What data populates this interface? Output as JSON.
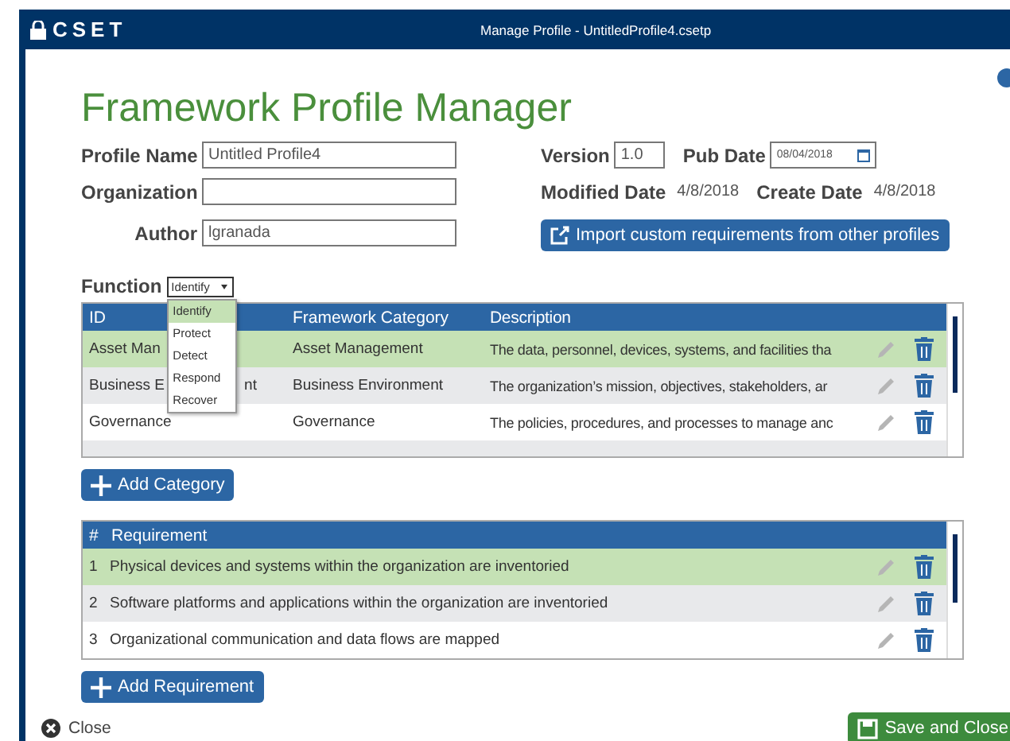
{
  "window": {
    "title": "Manage Profile - UntitledProfile4.csetp",
    "logo": "CSET"
  },
  "heading": "Framework Profile Manager",
  "form": {
    "profile_name": {
      "label": "Profile Name",
      "value": "Untitled Profile4"
    },
    "organization": {
      "label": "Organization"
    },
    "author": {
      "label": "Author",
      "value": "lgranada"
    },
    "version": {
      "label": "Version",
      "value": "1.0"
    },
    "pub_date": {
      "label": "Pub Date",
      "value": "08/04/2018"
    },
    "modified_date": {
      "label": "Modified Date",
      "value": "4/8/2018"
    },
    "create_date": {
      "label": "Create Date",
      "value": "4/8/2018"
    },
    "import_button": "Import custom requirements from other profiles"
  },
  "function": {
    "label": "Function",
    "value": "Identify",
    "expanded": true,
    "options": [
      {
        "label": "Identify",
        "selected": true
      },
      {
        "label": "Protect",
        "selected": false
      },
      {
        "label": "Detect",
        "selected": false
      },
      {
        "label": "Respond",
        "selected": false
      },
      {
        "label": "Recover",
        "selected": false
      }
    ]
  },
  "categories": {
    "columns": [
      "ID",
      "Framework Category",
      "Description"
    ],
    "rows": [
      {
        "id": "Asset Man",
        "id_tail": "",
        "category": "Asset Management",
        "description": "The data, personnel, devices, systems, and facilities tha",
        "selected": true
      },
      {
        "id": "Business E",
        "id_tail": "nt",
        "category": "Business Environment",
        "description": "The organization’s mission, objectives, stakeholders, ar",
        "selected": false
      },
      {
        "id": "Governance",
        "id_tail": "",
        "category": "Governance",
        "description": "The policies, procedures, and processes to manage anc",
        "selected": false
      }
    ]
  },
  "add_category": "Add Category",
  "requirements": {
    "columns": [
      "#",
      "Requirement"
    ],
    "rows": [
      {
        "number": "1",
        "text": "Physical devices and systems within the organization are inventoried",
        "selected": true
      },
      {
        "number": "2",
        "text": "Software platforms and applications within the organization are inventoried",
        "selected": false
      },
      {
        "number": "3",
        "text": "Organizational communication and data flows are mapped",
        "selected": false
      }
    ]
  },
  "add_requirement": "Add Requirement",
  "close": "Close",
  "save": "Save and Close"
}
